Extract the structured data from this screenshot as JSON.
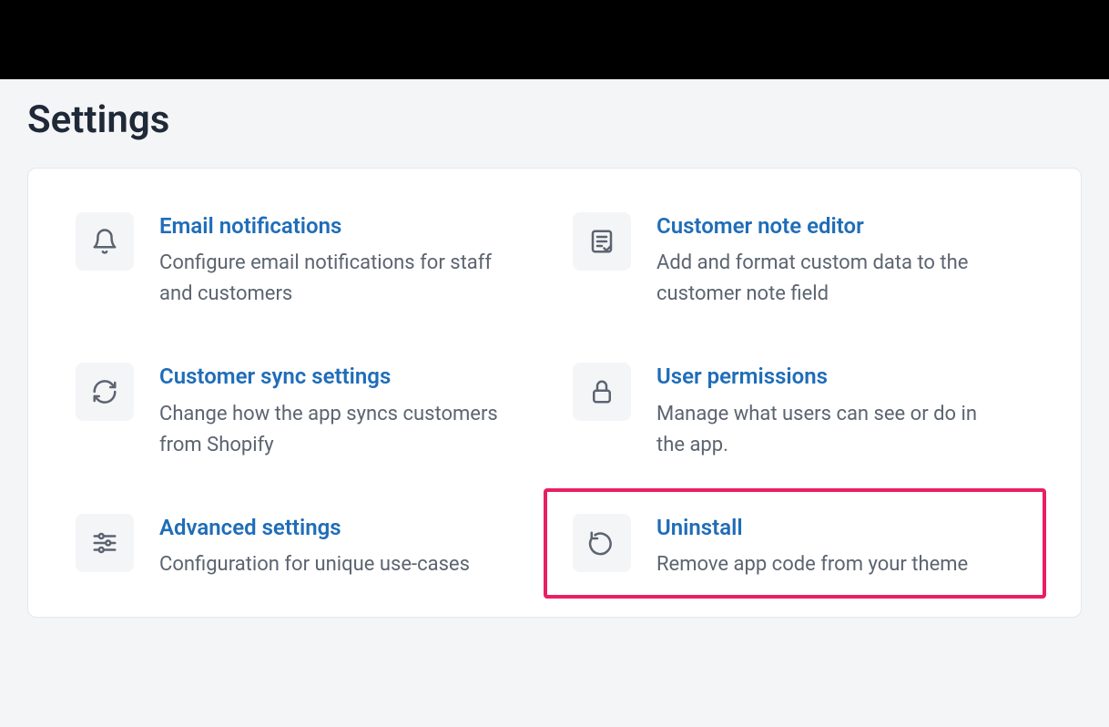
{
  "page": {
    "title": "Settings"
  },
  "settings": {
    "email_notifications": {
      "title": "Email notifications",
      "desc": "Configure email notifications for staff and customers"
    },
    "customer_note_editor": {
      "title": "Customer note editor",
      "desc": "Add and format custom data to the customer note field"
    },
    "customer_sync": {
      "title": "Customer sync settings",
      "desc": "Change how the app syncs customers from Shopify"
    },
    "user_permissions": {
      "title": "User permissions",
      "desc": "Manage what users can see or do in the app."
    },
    "advanced": {
      "title": "Advanced settings",
      "desc": "Configuration for unique use-cases"
    },
    "uninstall": {
      "title": "Uninstall",
      "desc": "Remove app code from your theme"
    }
  }
}
